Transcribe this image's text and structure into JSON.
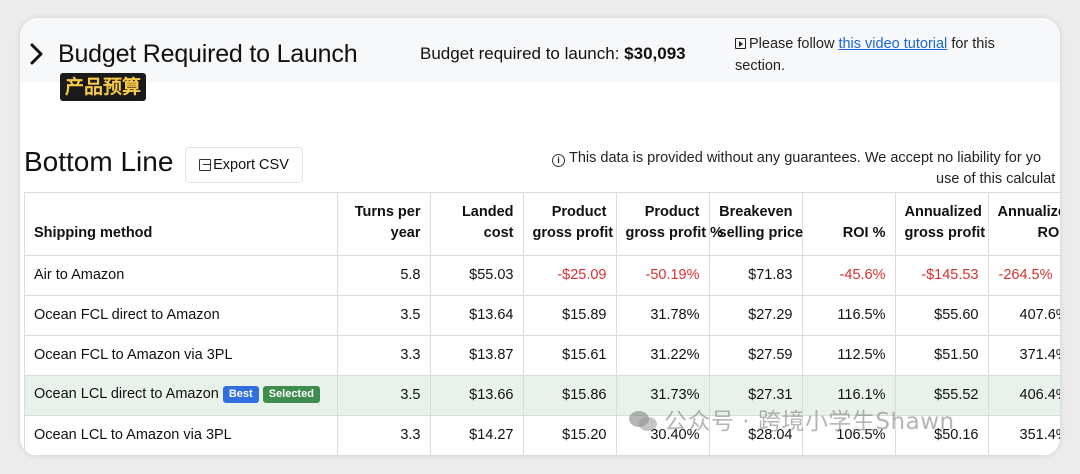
{
  "budget": {
    "title": "Budget Required to Launch",
    "zh_tag": "产品预算",
    "amount_label": "Budget required to launch:",
    "amount_value": "$30,093",
    "tutorial_prefix": "Please follow",
    "tutorial_link": "this video tutorial",
    "tutorial_suffix": "for this section."
  },
  "bottom_line": {
    "title": "Bottom Line",
    "export_label": "Export CSV",
    "disclaimer_line1": "This data is provided without any guarantees. We accept no liability for yo",
    "disclaimer_line2": "use of this calculat"
  },
  "table": {
    "columns": [
      {
        "line1": "Shipping method",
        "line2": ""
      },
      {
        "line1": "Turns per",
        "line2": "year"
      },
      {
        "line1": "Landed",
        "line2": "cost"
      },
      {
        "line1": "Product",
        "line2": "gross profit"
      },
      {
        "line1": "Product",
        "line2": "gross profit %"
      },
      {
        "line1": "Breakeven",
        "line2": "selling price"
      },
      {
        "line1": "",
        "line2": "ROI %"
      },
      {
        "line1": "Annualized",
        "line2": "gross profit"
      },
      {
        "line1": "Annualize",
        "line2": "ROI %"
      }
    ],
    "rows": [
      {
        "method": "Air to Amazon",
        "turns": "5.8",
        "landed": "$55.03",
        "gp": "-$25.09",
        "gp_pct": "-50.19%",
        "breakeven": "$71.83",
        "roi": "-45.6%",
        "ann_gp": "-$145.53",
        "ann_roi": "-264.5%"
      },
      {
        "method": "Ocean FCL direct to Amazon",
        "turns": "3.5",
        "landed": "$13.64",
        "gp": "$15.89",
        "gp_pct": "31.78%",
        "breakeven": "$27.29",
        "roi": "116.5%",
        "ann_gp": "$55.60",
        "ann_roi": "407.6%"
      },
      {
        "method": "Ocean FCL to Amazon via 3PL",
        "turns": "3.3",
        "landed": "$13.87",
        "gp": "$15.61",
        "gp_pct": "31.22%",
        "breakeven": "$27.59",
        "roi": "112.5%",
        "ann_gp": "$51.50",
        "ann_roi": "371.4%"
      },
      {
        "method": "Ocean LCL direct to Amazon",
        "badge_best": "Best",
        "badge_selected": "Selected",
        "turns": "3.5",
        "landed": "$13.66",
        "gp": "$15.86",
        "gp_pct": "31.73%",
        "breakeven": "$27.31",
        "roi": "116.1%",
        "ann_gp": "$55.52",
        "ann_roi": "406.4%"
      },
      {
        "method": "Ocean LCL to Amazon via 3PL",
        "turns": "3.3",
        "landed": "$14.27",
        "gp": "$15.20",
        "gp_pct": "30.40%",
        "breakeven": "$28.04",
        "roi": "106.5%",
        "ann_gp": "$50.16",
        "ann_roi": "351.4%"
      }
    ]
  },
  "watermark": "公众号 · 跨境小学生Shawn",
  "colors": {
    "negative": "#d6322f",
    "link": "#1a66d6",
    "best_badge": "#2f6fe0",
    "selected_badge": "#3f8d4e",
    "selected_row": "#e8f2ea"
  }
}
